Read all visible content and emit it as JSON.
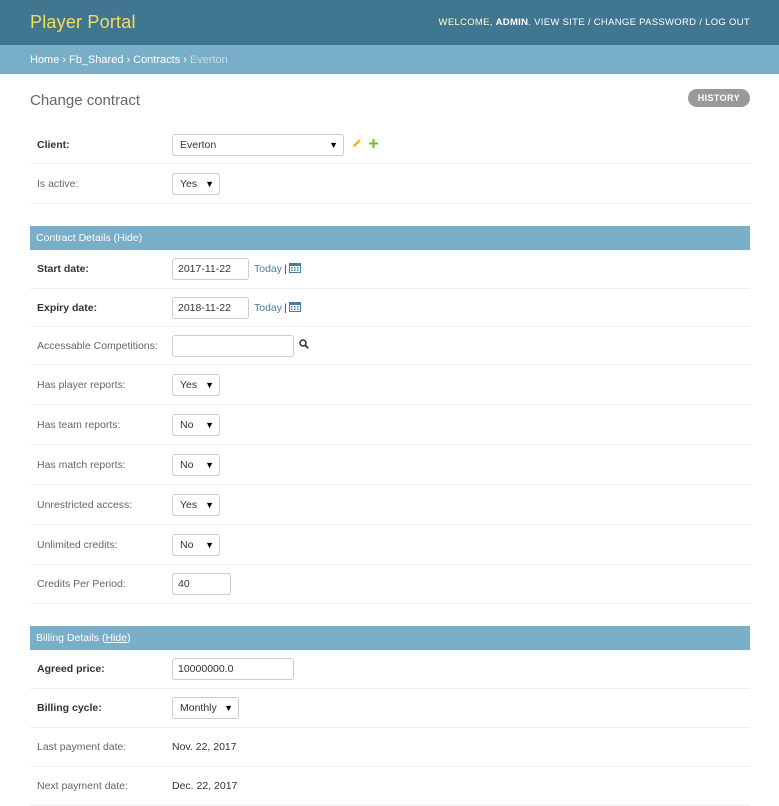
{
  "header": {
    "brand": "Player Portal",
    "welcome": "Welcome,",
    "username": "admin",
    "view_site": "View site",
    "change_password": "Change password",
    "logout": "Log out",
    "sep": "/"
  },
  "breadcrumbs": {
    "home": "Home",
    "app": "Fb_Shared",
    "model": "Contracts",
    "current": "Everton",
    "sep": "›"
  },
  "page": {
    "title": "Change contract",
    "history_label": "History"
  },
  "general": {
    "client_label": "Client:",
    "client_value": "Everton",
    "is_active_label": "Is active:",
    "is_active_value": "Yes"
  },
  "contract_details": {
    "caption": "Contract Details",
    "toggle": "(Hide)",
    "start_date_label": "Start date:",
    "start_date_value": "2017-11-22",
    "expiry_date_label": "Expiry date:",
    "expiry_date_value": "2018-11-22",
    "today": "Today",
    "pipe": "|",
    "competitions_label": "Accessable Competitions:",
    "competitions_value": "",
    "player_reports_label": "Has player reports:",
    "player_reports_value": "Yes",
    "team_reports_label": "Has team reports:",
    "team_reports_value": "No",
    "match_reports_label": "Has match reports:",
    "match_reports_value": "No",
    "unrestricted_label": "Unrestricted access:",
    "unrestricted_value": "Yes",
    "unlimited_label": "Unlimited credits:",
    "unlimited_value": "No",
    "credits_label": "Credits Per Period:",
    "credits_value": "40"
  },
  "billing_details": {
    "caption": "Billing Details",
    "toggle_open": "(",
    "toggle": "Hide",
    "toggle_close": ")",
    "price_label": "Agreed price:",
    "price_value": "10000000.0",
    "cycle_label": "Billing cycle:",
    "cycle_value": "Monthly",
    "last_payment_label": "Last payment date:",
    "last_payment_value": "Nov. 22, 2017",
    "next_payment_label": "Next payment date:",
    "next_payment_value": "Dec. 22, 2017"
  },
  "icons": {
    "caret": "▼"
  },
  "colors": {
    "header_bg": "#417690",
    "brand": "#f5dd5d",
    "breadcrumb_bg": "#79aec8",
    "link": "#447e9b",
    "edit_icon": "#efb80b",
    "add_icon": "#70bf2b"
  }
}
